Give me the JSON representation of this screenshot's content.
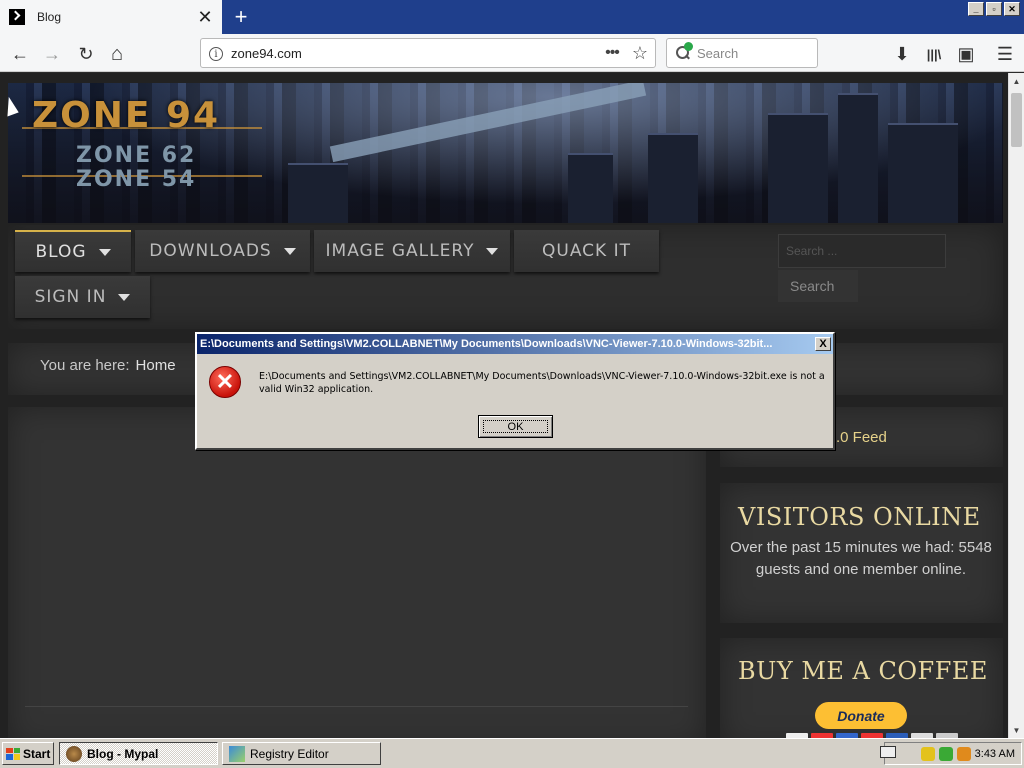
{
  "browser": {
    "tab_title": "Blog",
    "tab_close": "✕",
    "new_tab": "+",
    "url": "zone94.com",
    "url_info": "i",
    "page_actions": "•••",
    "bookmark_star": "☆",
    "search_placeholder": "Search",
    "back": "←",
    "forward": "→",
    "reload": "↻",
    "home": "⌂",
    "downloads": "⬇",
    "library": "|||\\",
    "sidebar": "▣",
    "menu": "☰",
    "win_minimize": "_",
    "win_maximize": "▫",
    "win_close": "✕"
  },
  "site": {
    "logo_main": "ZONE 94",
    "logo_sub1": "ZONE 62",
    "logo_sub2": "ZONE 54",
    "menu": [
      {
        "label": "BLOG",
        "caret": true
      },
      {
        "label": "DOWNLOADS",
        "caret": true
      },
      {
        "label": "IMAGE GALLERY",
        "caret": true
      },
      {
        "label": "QUACK IT",
        "caret": false
      },
      {
        "label": "SIGN IN",
        "caret": true
      }
    ],
    "search_placeholder": "Search ...",
    "search_button": "Search",
    "breadcrumb_prefix": "You are here:",
    "breadcrumb_home": "Home",
    "feed_link": ".0 Feed",
    "visitors_title": "VISITORS ONLINE",
    "visitors_text": "Over the past 15 minutes we had: 5548 guests and one member online.",
    "coffee_title": "BUY ME A COFFEE",
    "donate_label": "Donate"
  },
  "dialog": {
    "title": "E:\\Documents and Settings\\VM2.COLLABNET\\My Documents\\Downloads\\VNC-Viewer-7.10.0-Windows-32bit...",
    "close": "X",
    "message": "E:\\Documents and Settings\\VM2.COLLABNET\\My Documents\\Downloads\\VNC-Viewer-7.10.0-Windows-32bit.exe is not a valid Win32 application.",
    "ok_label": "OK",
    "icon": "error-x-icon"
  },
  "taskbar": {
    "start_label": "Start",
    "tasks": [
      {
        "label": "Blog - Mypal",
        "active": true
      },
      {
        "label": "Registry Editor",
        "active": false
      }
    ],
    "clock": "3:43 AM"
  },
  "colors": {
    "accent_gold": "#d6b24a",
    "heading_gold": "#e9d9a2",
    "titlebar": "#0a246a",
    "error_red": "#c8120a"
  }
}
